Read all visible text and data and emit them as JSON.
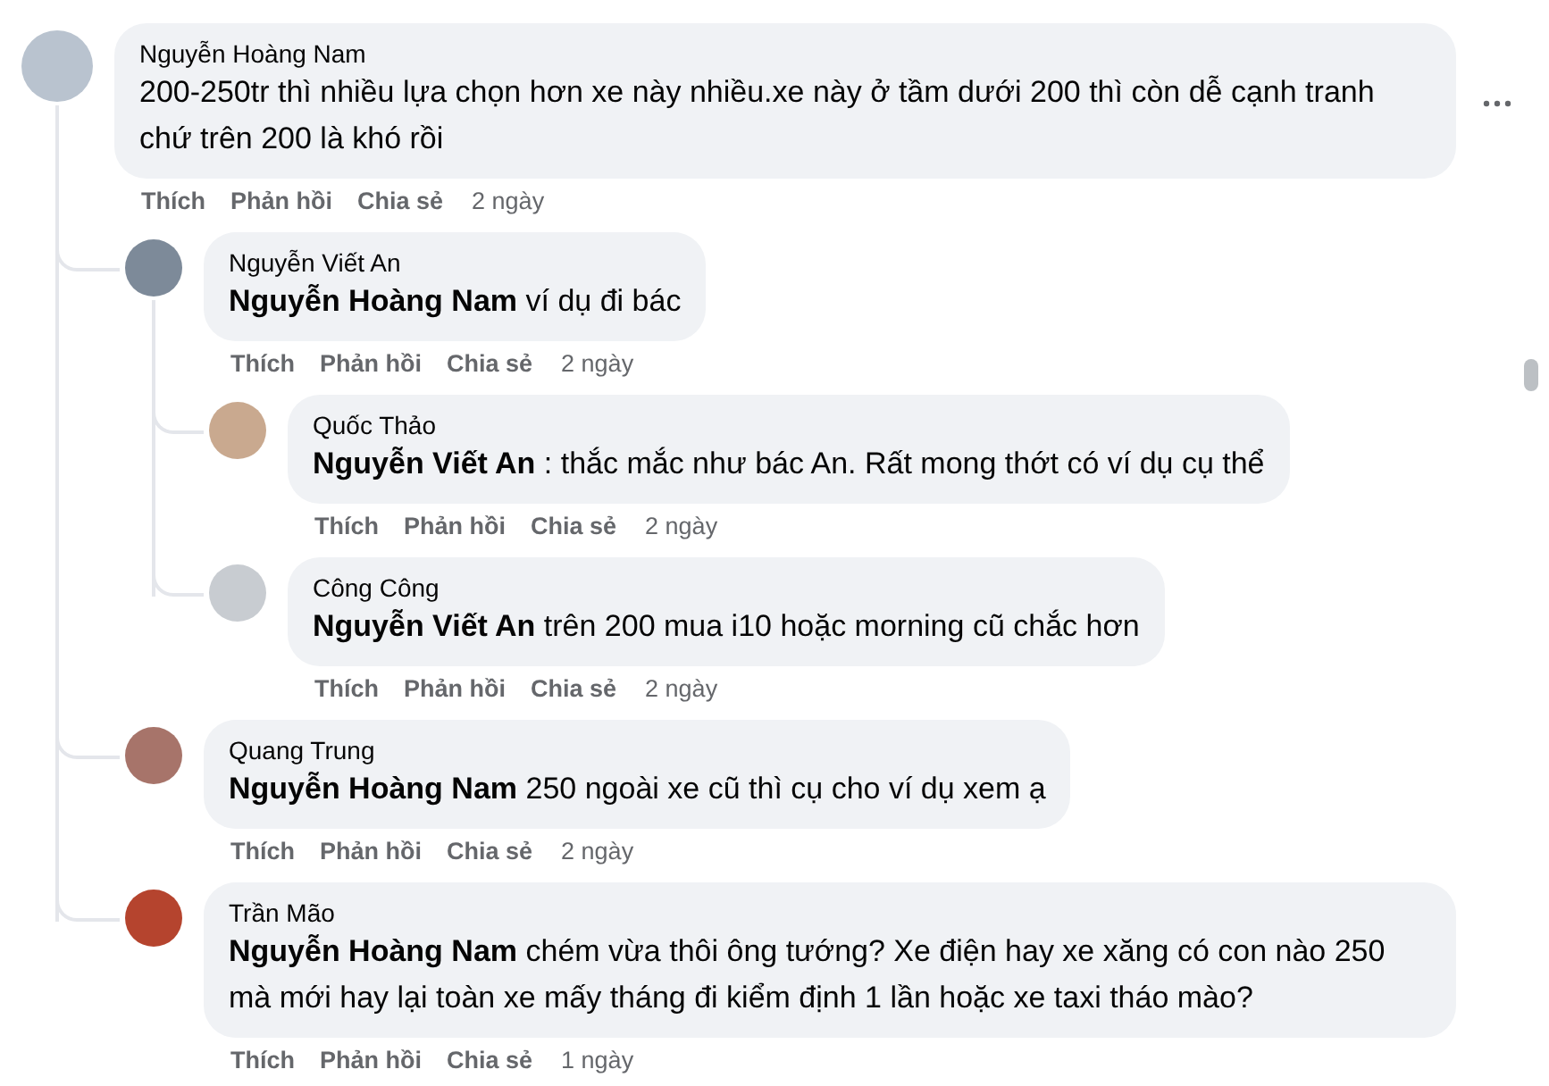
{
  "comments": [
    {
      "author": "Nguyễn Hoàng Nam",
      "text": "200-250tr thì nhiều lựa chọn hơn xe này nhiều.xe này ở tầm dưới 200 thì còn dễ cạnh tranh chứ trên 200 là khó rồi",
      "actions": [
        "Thích",
        "Phản hồi",
        "Chia sẻ"
      ],
      "time": "2 ngày",
      "more_options": true,
      "children": [
        {
          "author": "Nguyễn Viết An",
          "text": "**Nguyễn Hoàng Nam** ví dụ đi bác",
          "actions": [
            "Thích",
            "Phản hồi",
            "Chia sẻ"
          ],
          "time": "2 ngày",
          "more_options": false,
          "children": [
            {
              "author": "Quốc Thảo",
              "text": "**Nguyễn Viết An** : thắc mắc như bác An. Rất mong thớt có ví dụ cụ thể",
              "actions": [
                "Thích",
                "Phản hồi",
                "Chia sẻ"
              ],
              "time": "2 ngày",
              "more_options": false
            },
            {
              "author": "Công Công",
              "text": "**Nguyễn Viết An** trên 200 mua i10 hoặc morning cũ chắc hơn",
              "actions": [
                "Thích",
                "Phản hồi",
                "Chia sẻ"
              ],
              "time": "2 ngày",
              "more_options": false
            }
          ]
        },
        {
          "author": "Quang Trung",
          "text": "**Nguyễn Hoàng Nam** 250 ngoài xe cũ thì cụ cho ví dụ xem ạ",
          "actions": [
            "Thích",
            "Phản hồi",
            "Chia sẻ"
          ],
          "time": "2 ngày",
          "more_options": false
        },
        {
          "author": "Trần Mão",
          "text": "**Nguyễn Hoàng Nam** chém vừa thôi ông tướng? Xe điện hay xe xăng có con nào 250 mà mới hay lại toàn xe mấy tháng đi kiểm định 1 lần hoặc xe taxi tháo mào?",
          "actions": [
            "Thích",
            "Phản hồi",
            "Chia sẻ"
          ],
          "time": "1 ngày",
          "more_options": false
        }
      ]
    }
  ]
}
